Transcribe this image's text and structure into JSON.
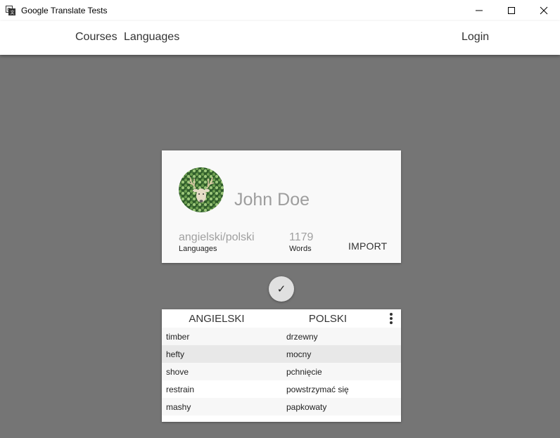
{
  "window": {
    "title": "Google Translate Tests",
    "app_icon": "translate-icon",
    "controls": [
      "minimize-icon",
      "maximize-icon",
      "close-icon"
    ]
  },
  "nav": {
    "courses": "Courses",
    "languages": "Languages",
    "login": "Login"
  },
  "profile": {
    "avatar": "deer-avatar",
    "name": "John Doe",
    "languages_value": "angielski/polski",
    "languages_label": "Languages",
    "words_value": "1179",
    "words_label": "Words",
    "import_label": "IMPORT"
  },
  "check_button": {
    "label": "✓"
  },
  "table": {
    "headers": [
      "ANGIELSKI",
      "POLSKI"
    ],
    "menu_icon": "more-vert-icon",
    "selected_row": 1,
    "rows": [
      [
        "timber",
        "drzewny"
      ],
      [
        "hefty",
        "mocny"
      ],
      [
        "shove",
        "pchnięcie"
      ],
      [
        "restrain",
        "powstrzymać się"
      ],
      [
        "mashy",
        "papkowaty"
      ]
    ]
  },
  "colors": {
    "background": "#757575",
    "card": "#f9f9f9",
    "name_text": "#9e9e9e"
  }
}
